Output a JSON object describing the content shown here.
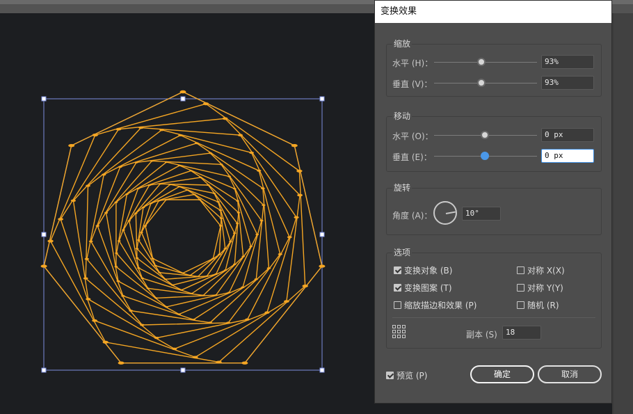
{
  "dialog": {
    "title": "变换效果",
    "scale": {
      "title": "缩放",
      "horizontal_label": "水平 (H)：",
      "horizontal_value": "93%",
      "horizontal_level": 0.46,
      "vertical_label": "垂直 (V)：",
      "vertical_value": "93%",
      "vertical_level": 0.46
    },
    "move": {
      "title": "移动",
      "horizontal_label": "水平 (O)：",
      "horizontal_value": "0 px",
      "horizontal_level": 0.5,
      "vertical_label": "垂直 (E)：",
      "vertical_value": "0 px",
      "vertical_level": 0.5
    },
    "rotate": {
      "title": "旋转",
      "angle_label": "角度 (A)：",
      "angle_value": "10°",
      "angle_degrees": 10
    },
    "options": {
      "title": "选项",
      "transform_objects": {
        "label": "变换对象 (B)",
        "checked": true
      },
      "transform_patterns": {
        "label": "变换图案 (T)",
        "checked": true
      },
      "scale_strokes": {
        "label": "缩放描边和效果 (P)",
        "checked": false
      },
      "reflect_x": {
        "label": "对称 X(X)",
        "checked": false
      },
      "reflect_y": {
        "label": "对称 Y(Y)",
        "checked": false
      },
      "random": {
        "label": "随机 (R)",
        "checked": false
      },
      "copies_label": "副本 (S)",
      "copies_value": "18"
    },
    "preview": {
      "label": "预览 (P)",
      "checked": true
    },
    "ok_label": "确定",
    "cancel_label": "取消"
  },
  "artwork": {
    "stroke_color": "#f5a623",
    "bounding_color": "#7b8fe0",
    "copies": 18,
    "rotation_step_degrees": 10,
    "scale_step": 0.93
  }
}
